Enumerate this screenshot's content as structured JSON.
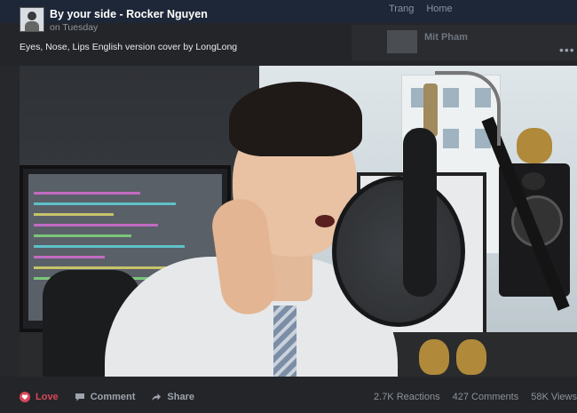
{
  "post": {
    "title": "By your side - Rocker Nguyen",
    "time": "on Tuesday",
    "description": "Eyes, Nose, Lips English version cover by LongLong"
  },
  "background": {
    "nav_items": [
      "Trang",
      "Home"
    ],
    "suggest_name": "Mit Pham",
    "more": "•••"
  },
  "actions": {
    "love": "Love",
    "comment": "Comment",
    "share": "Share"
  },
  "stats": {
    "reactions": "2.7K Reactions",
    "comments": "427 Comments",
    "views": "58K Views"
  },
  "colors": {
    "love": "#d8475a",
    "muted": "#9ea4ad",
    "background": "#1c1e21"
  }
}
